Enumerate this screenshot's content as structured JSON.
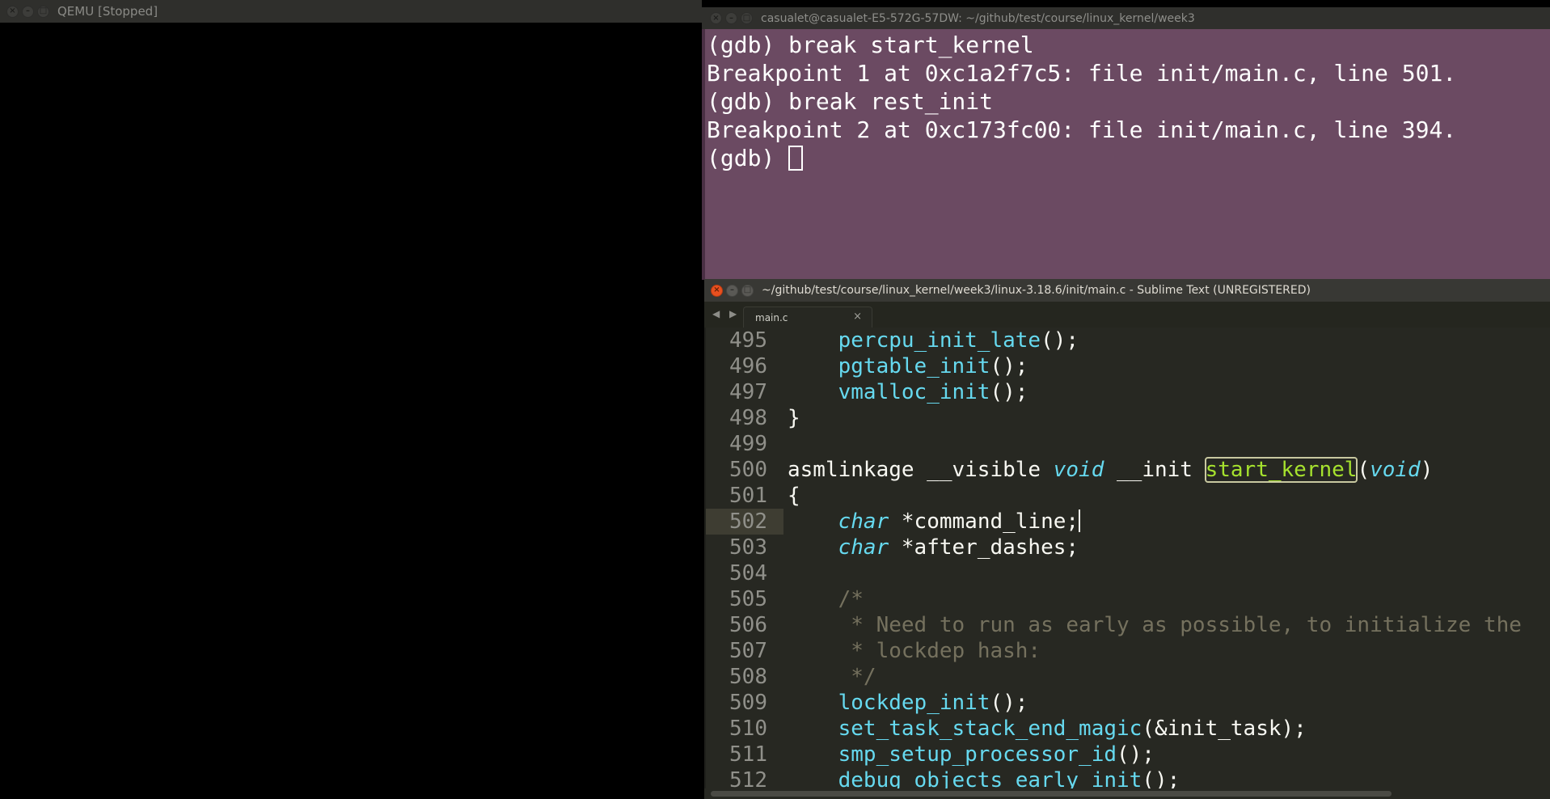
{
  "qemu": {
    "title": "QEMU [Stopped]"
  },
  "terminal": {
    "title": "casualet@casualet-E5-572G-57DW: ~/github/test/course/linux_kernel/week3",
    "lines": [
      "(gdb) break start_kernel",
      "Breakpoint 1 at 0xc1a2f7c5: file init/main.c, line 501.",
      "(gdb) break rest_init",
      "Breakpoint 2 at 0xc173fc00: file init/main.c, line 394."
    ],
    "prompt": "(gdb) "
  },
  "sublime": {
    "title": "~/github/test/course/linux_kernel/week3/linux-3.18.6/init/main.c - Sublime Text (UNREGISTERED)",
    "nav_arrows": "◀ ▶",
    "tab_label": "main.c",
    "tab_close": "×",
    "current_line": "502",
    "lines": [
      {
        "num": "495",
        "parts": [
          {
            "t": "    "
          },
          {
            "t": "percpu_init_late",
            "c": "t-fn"
          },
          {
            "t": "();"
          }
        ]
      },
      {
        "num": "496",
        "parts": [
          {
            "t": "    "
          },
          {
            "t": "pgtable_init",
            "c": "t-fn"
          },
          {
            "t": "();"
          }
        ]
      },
      {
        "num": "497",
        "parts": [
          {
            "t": "    "
          },
          {
            "t": "vmalloc_init",
            "c": "t-fn"
          },
          {
            "t": "();"
          }
        ]
      },
      {
        "num": "498",
        "parts": [
          {
            "t": "}"
          }
        ]
      },
      {
        "num": "499",
        "parts": []
      },
      {
        "num": "500",
        "parts": [
          {
            "t": "asmlinkage __visible "
          },
          {
            "t": "void",
            "c": "t-kw"
          },
          {
            "t": " __init "
          },
          {
            "t": "start_kernel",
            "c": "t-def"
          },
          {
            "t": "("
          },
          {
            "t": "void",
            "c": "t-kw"
          },
          {
            "t": ")"
          }
        ]
      },
      {
        "num": "501",
        "parts": [
          {
            "t": "{"
          }
        ]
      },
      {
        "num": "502",
        "parts": [
          {
            "t": "    "
          },
          {
            "t": "char",
            "c": "t-kw"
          },
          {
            "t": " *command_line;"
          }
        ],
        "caret": true
      },
      {
        "num": "503",
        "parts": [
          {
            "t": "    "
          },
          {
            "t": "char",
            "c": "t-kw"
          },
          {
            "t": " *after_dashes;"
          }
        ]
      },
      {
        "num": "504",
        "parts": []
      },
      {
        "num": "505",
        "parts": [
          {
            "t": "    "
          },
          {
            "t": "/*",
            "c": "t-cm"
          }
        ]
      },
      {
        "num": "506",
        "parts": [
          {
            "t": "     "
          },
          {
            "t": "* Need to run as early as possible, to initialize the",
            "c": "t-cm"
          }
        ]
      },
      {
        "num": "507",
        "parts": [
          {
            "t": "     "
          },
          {
            "t": "* lockdep hash:",
            "c": "t-cm"
          }
        ]
      },
      {
        "num": "508",
        "parts": [
          {
            "t": "     "
          },
          {
            "t": "*/",
            "c": "t-cm"
          }
        ]
      },
      {
        "num": "509",
        "parts": [
          {
            "t": "    "
          },
          {
            "t": "lockdep_init",
            "c": "t-fn"
          },
          {
            "t": "();"
          }
        ]
      },
      {
        "num": "510",
        "parts": [
          {
            "t": "    "
          },
          {
            "t": "set_task_stack_end_magic",
            "c": "t-fn"
          },
          {
            "t": "(&init_task);"
          }
        ]
      },
      {
        "num": "511",
        "parts": [
          {
            "t": "    "
          },
          {
            "t": "smp_setup_processor_id",
            "c": "t-fn"
          },
          {
            "t": "();"
          }
        ]
      },
      {
        "num": "512",
        "parts": [
          {
            "t": "    "
          },
          {
            "t": "debug_objects_early_init",
            "c": "t-fn"
          },
          {
            "t": "();"
          }
        ]
      }
    ]
  },
  "colors": {
    "terminal_bg": "#6b4a62",
    "editor_bg": "#272822",
    "function": "#66d9ef",
    "definition": "#a6e22e",
    "comment": "#75715e"
  }
}
